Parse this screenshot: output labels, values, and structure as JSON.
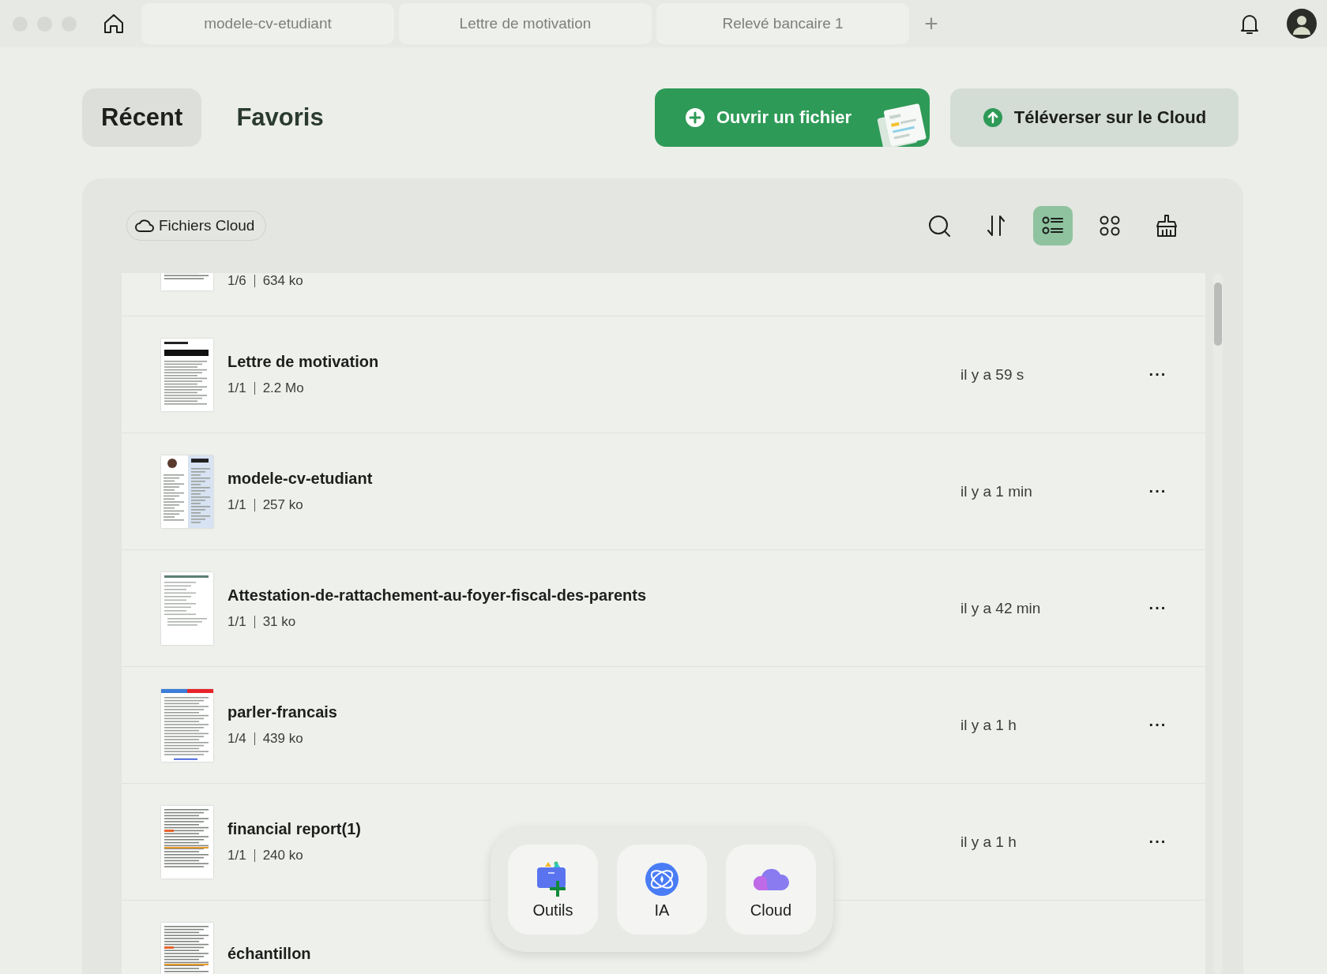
{
  "window": {
    "doc_tabs": [
      {
        "label": "modele-cv-etudiant",
        "selected": false
      },
      {
        "label": "Lettre de motivation",
        "selected": false
      },
      {
        "label": "Relevé bancaire 1",
        "selected": false
      }
    ],
    "new_tab": "+"
  },
  "tabs": [
    {
      "label": "Récent",
      "selected": true
    },
    {
      "label": "Favoris",
      "selected": false
    }
  ],
  "actions": [
    {
      "kind": "open",
      "label": "Ouvrir un fichier"
    },
    {
      "kind": "upload",
      "label": "Téléverser sur le Cloud"
    }
  ],
  "filter": {
    "label": "Fichiers Cloud"
  },
  "toolbar": [
    {
      "kind": "search",
      "selected": false
    },
    {
      "kind": "sort",
      "selected": false
    },
    {
      "kind": "list-view",
      "selected": true
    },
    {
      "kind": "grid-view",
      "selected": false
    },
    {
      "kind": "clean",
      "selected": false
    }
  ],
  "files": [
    {
      "pages": "1/6",
      "size": "634 ko"
    },
    {
      "name": "Lettre de motivation",
      "pages": "1/1",
      "size": "2.2 Mo",
      "time": "il y a 59 s"
    },
    {
      "name": "modele-cv-etudiant",
      "pages": "1/1",
      "size": "257 ko",
      "time": "il y a 1 min"
    },
    {
      "name": "Attestation-de-rattachement-au-foyer-fiscal-des-parents",
      "pages": "1/1",
      "size": "31 ko",
      "time": "il y a 42 min"
    },
    {
      "name": "parler-francais",
      "pages": "1/4",
      "size": "439 ko",
      "time": "il y a 1 h"
    },
    {
      "name": "financial report(1)",
      "pages": "1/1",
      "size": "240 ko",
      "time": "il y a 1 h"
    },
    {
      "name": "échantillon"
    }
  ],
  "more": "···",
  "dock": [
    {
      "kind": "tools",
      "label": "Outils"
    },
    {
      "kind": "ai",
      "label": "IA"
    },
    {
      "kind": "cloud",
      "label": "Cloud"
    }
  ]
}
